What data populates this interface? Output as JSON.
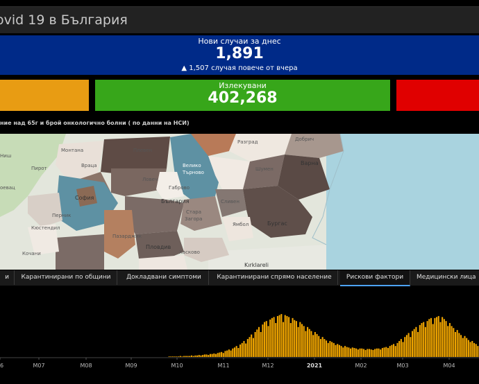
{
  "header": {
    "title": "ovid 19 в България"
  },
  "new_cases": {
    "label": "Нови случаи за днес",
    "value": "1,891",
    "delta": "▲ 1,507 случая повече от вчера"
  },
  "tiles": {
    "left_color": "#e89c13",
    "recovered": {
      "label": "Излекувани",
      "value": "402,268",
      "color": "#37a61a"
    },
    "right_color": "#e00000"
  },
  "map": {
    "title": "ние над 65г и брой онкологично болни ( по данни на НСИ)",
    "labels": [
      {
        "text": "Монтана"
      },
      {
        "text": "Плевен"
      },
      {
        "text": "Разград"
      },
      {
        "text": "Добрич"
      },
      {
        "text": "Ниш"
      },
      {
        "text": "Враца"
      },
      {
        "text": "Велико"
      },
      {
        "text": "Търново"
      },
      {
        "text": "Шумен"
      },
      {
        "text": "Варна"
      },
      {
        "text": "Пирот"
      },
      {
        "text": "Ловеч"
      },
      {
        "text": "Габрово"
      },
      {
        "text": "Сливен"
      },
      {
        "text": "София"
      },
      {
        "text": "България"
      },
      {
        "text": "Стара"
      },
      {
        "text": "Загора"
      },
      {
        "text": "Бургас"
      },
      {
        "text": "Ямбол"
      },
      {
        "text": "Перник"
      },
      {
        "text": "Пазарджик"
      },
      {
        "text": "Хасково"
      },
      {
        "text": "Пловдив"
      },
      {
        "text": "Кочани"
      },
      {
        "text": "Kırklareli"
      },
      {
        "text": "Кюстендил"
      },
      {
        "text": "оевац"
      }
    ]
  },
  "tabs": [
    {
      "label": "и"
    },
    {
      "label": "Карантинирани по общини"
    },
    {
      "label": "Докладвани симптоми"
    },
    {
      "label": "Карантинирани спрямо население"
    },
    {
      "label": "Рискови фактори"
    },
    {
      "label": "Медицински лица"
    }
  ],
  "chart_data": {
    "type": "bar",
    "title": "",
    "xlabel": "",
    "ylabel": "",
    "bar_color": "#f0a500",
    "x_ticks": [
      "6",
      "M07",
      "M08",
      "M09",
      "M10",
      "M11",
      "M12",
      "2021",
      "M02",
      "M03",
      "M04"
    ],
    "x_ticks_bold": [
      "2021"
    ],
    "values": [
      0,
      0,
      0,
      0,
      0,
      0,
      0,
      0,
      0,
      0,
      0,
      0,
      0,
      0,
      0,
      0,
      0,
      0,
      0,
      0,
      0,
      0,
      0,
      0,
      0,
      0,
      0,
      0,
      0,
      0,
      0,
      0,
      0,
      0,
      0,
      0,
      0,
      0,
      0,
      0,
      0,
      0,
      0,
      0,
      0,
      0,
      0,
      0,
      0,
      0,
      0,
      0,
      0,
      0,
      0,
      0,
      0,
      0,
      0,
      0,
      0,
      0,
      0,
      0,
      0,
      0,
      0,
      0,
      0,
      0,
      0,
      0,
      0,
      0,
      0,
      0,
      0,
      0,
      0,
      0,
      0,
      0,
      0,
      0,
      0,
      0,
      0,
      0,
      0,
      0,
      1,
      1,
      1,
      1,
      1,
      1,
      2,
      1,
      2,
      2,
      2,
      2,
      3,
      2,
      3,
      3,
      4,
      3,
      4,
      5,
      5,
      4,
      6,
      6,
      7,
      6,
      8,
      9,
      10,
      8,
      12,
      13,
      15,
      13,
      17,
      19,
      22,
      18,
      25,
      28,
      32,
      27,
      36,
      40,
      45,
      38,
      50,
      55,
      60,
      50,
      65,
      70,
      72,
      62,
      75,
      78,
      80,
      68,
      82,
      84,
      86,
      70,
      84,
      82,
      80,
      68,
      78,
      74,
      72,
      60,
      70,
      66,
      62,
      52,
      60,
      56,
      52,
      44,
      50,
      46,
      42,
      36,
      40,
      36,
      33,
      28,
      32,
      30,
      28,
      24,
      26,
      24,
      22,
      19,
      22,
      20,
      19,
      17,
      19,
      18,
      17,
      15,
      17,
      17,
      16,
      14,
      16,
      16,
      15,
      14,
      16,
      17,
      17,
      15,
      18,
      19,
      20,
      18,
      22,
      24,
      26,
      22,
      28,
      32,
      36,
      30,
      40,
      44,
      48,
      40,
      52,
      56,
      60,
      50,
      64,
      68,
      70,
      60,
      72,
      76,
      78,
      66,
      78,
      80,
      82,
      70,
      80,
      76,
      72,
      62,
      68,
      62,
      58,
      50,
      54,
      48,
      44,
      38,
      42,
      38,
      34,
      30,
      32,
      28,
      26,
      22
    ],
    "ylim": [
      0,
      100
    ],
    "grid": false
  }
}
